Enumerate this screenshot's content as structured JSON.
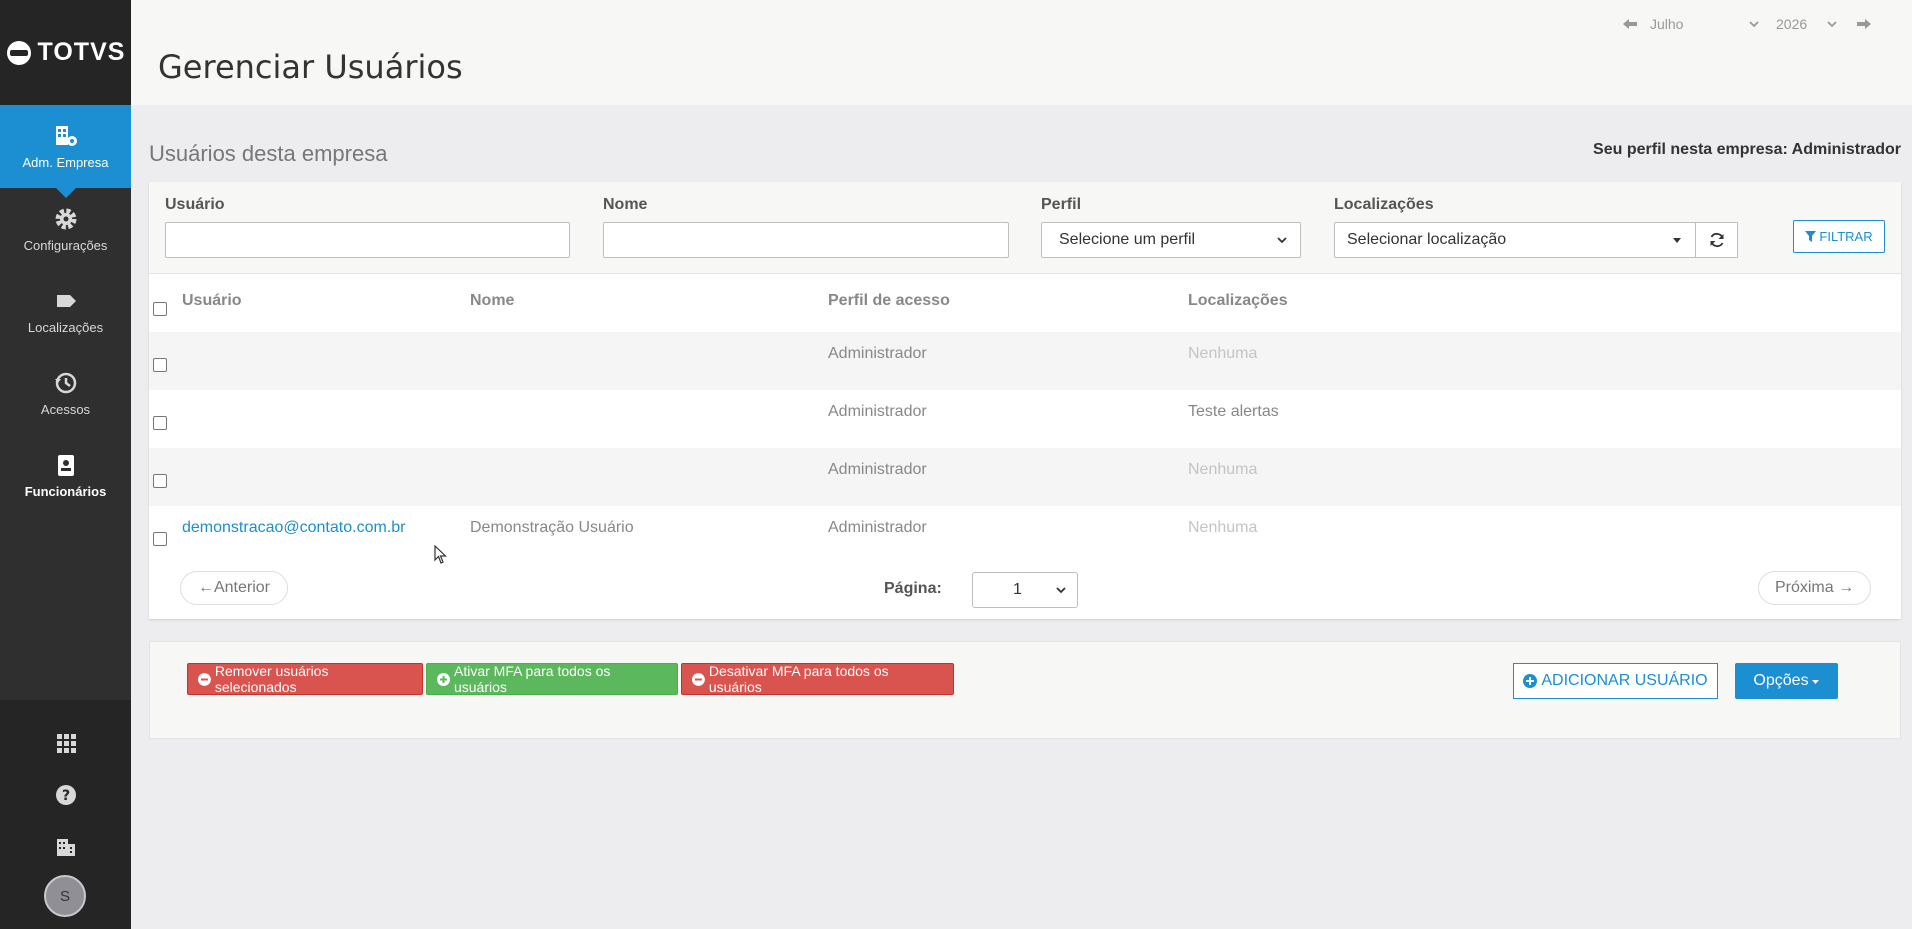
{
  "brand": {
    "name": "TOTVS"
  },
  "sidebar": {
    "items": [
      {
        "label": "Adm. Empresa",
        "icon": "building-gear-icon",
        "active": true
      },
      {
        "label": "Configurações",
        "icon": "gear-icon"
      },
      {
        "label": "Localizações",
        "icon": "tag-icon"
      },
      {
        "label": "Acessos",
        "icon": "history-icon"
      },
      {
        "label": "Funcionários",
        "icon": "badge-icon"
      }
    ],
    "bottom": [
      "apps-grid-icon",
      "help-icon",
      "company-icon"
    ],
    "avatar_initial": "S"
  },
  "header": {
    "title": "Gerenciar Usuários",
    "month": "Julho",
    "year": "2026"
  },
  "section": {
    "title": "Usuários desta empresa",
    "profile_label": "Seu perfil nesta empresa:",
    "profile_value": "Administrador"
  },
  "filters": {
    "usuario_label": "Usuário",
    "usuario_value": "",
    "nome_label": "Nome",
    "nome_value": "",
    "perfil_label": "Perfil",
    "perfil_value": "Selecione um perfil",
    "localizacoes_label": "Localizações",
    "localizacoes_value": "Selecionar localização",
    "filter_button": "FILTRAR"
  },
  "table": {
    "columns": [
      "Usuário",
      "Nome",
      "Perfil de acesso",
      "Localizações"
    ],
    "rows": [
      {
        "usuario": "",
        "nome": "",
        "perfil": "Administrador",
        "localizacoes": "Nenhuma"
      },
      {
        "usuario": "",
        "nome": "",
        "perfil": "Administrador",
        "localizacoes": "Teste alertas"
      },
      {
        "usuario": "",
        "nome": "",
        "perfil": "Administrador",
        "localizacoes": "Nenhuma"
      },
      {
        "usuario": "demonstracao@contato.com.br",
        "nome": "Demonstração Usuário",
        "perfil": "Administrador",
        "localizacoes": "Nenhuma"
      }
    ]
  },
  "pager": {
    "prev": "←Anterior",
    "page_label": "Página:",
    "page_value": "1",
    "next": "Próxima →"
  },
  "actions": {
    "remove": "Remover usuários selecionados",
    "enable_mfa": "Ativar MFA para todos os usuários",
    "disable_mfa": "Desativar MFA para todos os usuários",
    "add_user": "ADICIONAR USUÁRIO",
    "options": "Opções"
  },
  "colors": {
    "primary": "#1b8fd1",
    "danger": "#d9534f",
    "success": "#5cb85c",
    "sidebar": "#2f2f30"
  }
}
